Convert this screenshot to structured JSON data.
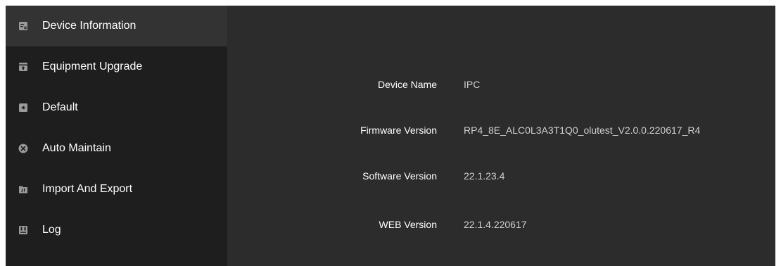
{
  "sidebar": {
    "items": [
      {
        "label": "Device Information",
        "icon": "device-info-icon"
      },
      {
        "label": "Equipment Upgrade",
        "icon": "upgrade-icon"
      },
      {
        "label": "Default",
        "icon": "default-icon"
      },
      {
        "label": "Auto Maintain",
        "icon": "auto-maintain-icon"
      },
      {
        "label": "Import And Export",
        "icon": "import-export-icon"
      },
      {
        "label": "Log",
        "icon": "log-icon"
      }
    ],
    "active_index": 0
  },
  "device_info": {
    "rows": [
      {
        "label": "Device Name",
        "value": "IPC"
      },
      {
        "label": "Firmware Version",
        "value": "RP4_8E_ALC0L3A3T1Q0_olutest_V2.0.0.220617_R4"
      },
      {
        "label": "Software Version",
        "value": "22.1.23.4"
      },
      {
        "label": "WEB Version",
        "value": "22.1.4.220617"
      }
    ]
  },
  "colors": {
    "sidebar_bg": "#1e1e1e",
    "active_item_bg": "#333333",
    "main_bg": "#2c2c2c",
    "icon": "#9a9a9a"
  }
}
